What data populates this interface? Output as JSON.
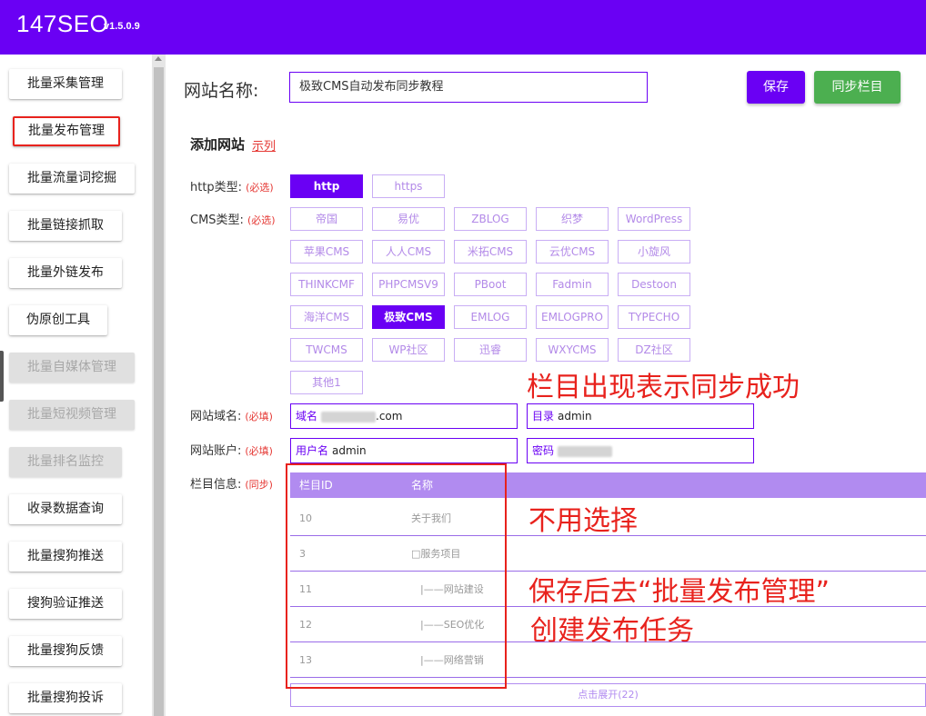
{
  "app": {
    "title": "147SEO",
    "version": "v1.5.0.9"
  },
  "sidebar": {
    "items": [
      {
        "label": "批量采集管理",
        "state": "normal"
      },
      {
        "label": "批量发布管理",
        "state": "active"
      },
      {
        "label": "批量流量词挖掘",
        "state": "normal"
      },
      {
        "label": "批量链接抓取",
        "state": "normal"
      },
      {
        "label": "批量外链发布",
        "state": "normal"
      },
      {
        "label": "伪原创工具",
        "state": "normal"
      },
      {
        "label": "批量自媒体管理",
        "state": "disabled"
      },
      {
        "label": "批量短视频管理",
        "state": "disabled"
      },
      {
        "label": "批量排名监控",
        "state": "disabled"
      },
      {
        "label": "收录数据查询",
        "state": "normal"
      },
      {
        "label": "批量搜狗推送",
        "state": "normal"
      },
      {
        "label": "搜狗验证推送",
        "state": "normal"
      },
      {
        "label": "批量搜狗反馈",
        "state": "normal"
      },
      {
        "label": "批量搜狗投诉",
        "state": "normal"
      }
    ]
  },
  "header": {
    "site_name_label": "网站名称:",
    "site_name_value": "极致CMS自动发布同步教程",
    "save_label": "保存",
    "sync_label": "同步栏目"
  },
  "form": {
    "add_title": "添加网站",
    "example_link": "示列",
    "http_label": "http类型:",
    "http_req": "(必选)",
    "http_options": [
      "http",
      "https"
    ],
    "http_selected": "http",
    "cms_label": "CMS类型:",
    "cms_req": "(必选)",
    "cms_options": [
      "帝国",
      "易优",
      "ZBLOG",
      "织梦",
      "WordPress",
      "苹果CMS",
      "人人CMS",
      "米拓CMS",
      "云优CMS",
      "小旋风",
      "THINKCMF",
      "PHPCMSV9",
      "PBoot",
      "Fadmin",
      "Destoon",
      "海洋CMS",
      "极致CMS",
      "EMLOG",
      "EMLOGPRO",
      "TYPECHO",
      "TWCMS",
      "WP社区",
      "迅睿",
      "WXYCMS",
      "DZ社区",
      "其他1"
    ],
    "cms_selected": "极致CMS",
    "domain_label": "网站域名:",
    "domain_req": "(必填)",
    "domain_key": "域名",
    "domain_suffix": ".com",
    "dir_key": "目录",
    "dir_value": "admin",
    "account_label": "网站账户:",
    "account_req": "(必填)",
    "user_key": "用户名",
    "user_value": "admin",
    "pass_key": "密码",
    "columns_label": "栏目信息:",
    "columns_req": "(同步)"
  },
  "columns_table": {
    "headers": [
      "栏目ID",
      "名称"
    ],
    "rows": [
      {
        "id": "10",
        "name": "关于我们"
      },
      {
        "id": "3",
        "name": "□服务项目"
      },
      {
        "id": "11",
        "name": "|——网站建设"
      },
      {
        "id": "12",
        "name": "|——SEO优化"
      },
      {
        "id": "13",
        "name": "|——网络营销"
      }
    ],
    "expand_label": "点击展开(22)"
  },
  "annotations": {
    "a1": "栏目出现表示同步成功",
    "a2": "不用选择",
    "a3": "保存后去“批量发布管理”",
    "a4": "创建发布任务"
  },
  "colors": {
    "brand": "#6a00f4",
    "sync": "#4caf50",
    "annotation": "#e8221d"
  }
}
